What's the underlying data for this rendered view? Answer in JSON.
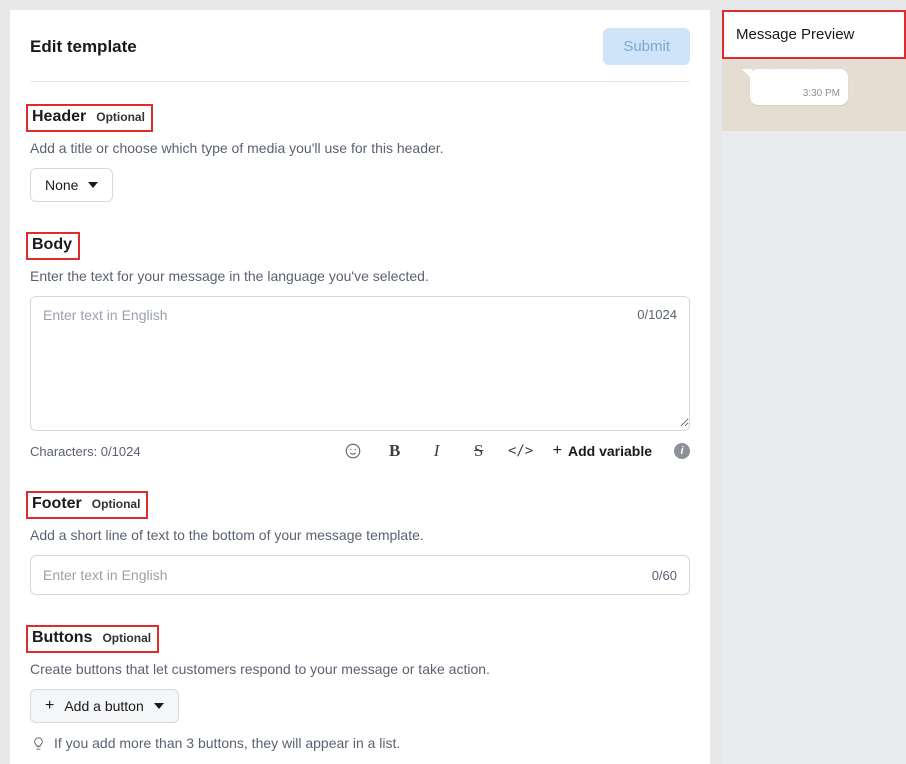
{
  "page": {
    "title": "Edit template",
    "submit": "Submit"
  },
  "header": {
    "title": "Header",
    "tag": "Optional",
    "desc": "Add a title or choose which type of media you'll use for this header.",
    "dropdown_value": "None"
  },
  "body": {
    "title": "Body",
    "desc": "Enter the text for your message in the language you've selected.",
    "placeholder": "Enter text in English",
    "counter_in": "0/1024",
    "char_line": "Characters: 0/1024",
    "add_variable": "Add variable"
  },
  "footer": {
    "title": "Footer",
    "tag": "Optional",
    "desc": "Add a short line of text to the bottom of your message template.",
    "placeholder": "Enter text in English",
    "counter": "0/60"
  },
  "buttons": {
    "title": "Buttons",
    "tag": "Optional",
    "desc": "Create buttons that let customers respond to your message or take action.",
    "add_label": "Add a button",
    "hint": "If you add more than 3 buttons, they will appear in a list."
  },
  "preview": {
    "title": "Message Preview",
    "bubble_time": "3:30 PM"
  }
}
